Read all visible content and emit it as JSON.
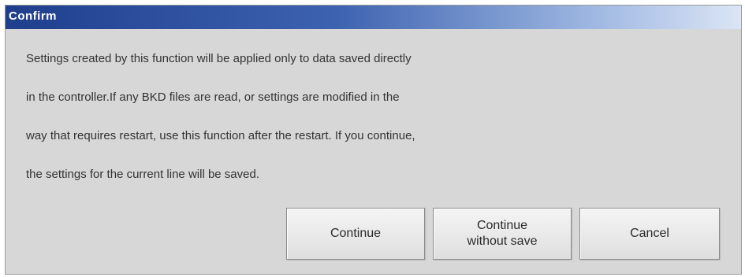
{
  "dialog": {
    "title": "Confirm",
    "message_lines": [
      "Settings created by this function will be applied only to data saved directly",
      "in the controller.If any BKD files are read, or settings are modified in the",
      "way that requires restart, use this function after the restart. If you continue,",
      "the settings for the current line will be saved."
    ],
    "buttons": {
      "continue": "Continue",
      "continue_without_save": "Continue\nwithout save",
      "cancel": "Cancel"
    }
  },
  "colors": {
    "titlebar_start": "#1f3f8d",
    "titlebar_end": "#dbe5f5",
    "dialog_background": "#d7d7d7"
  }
}
